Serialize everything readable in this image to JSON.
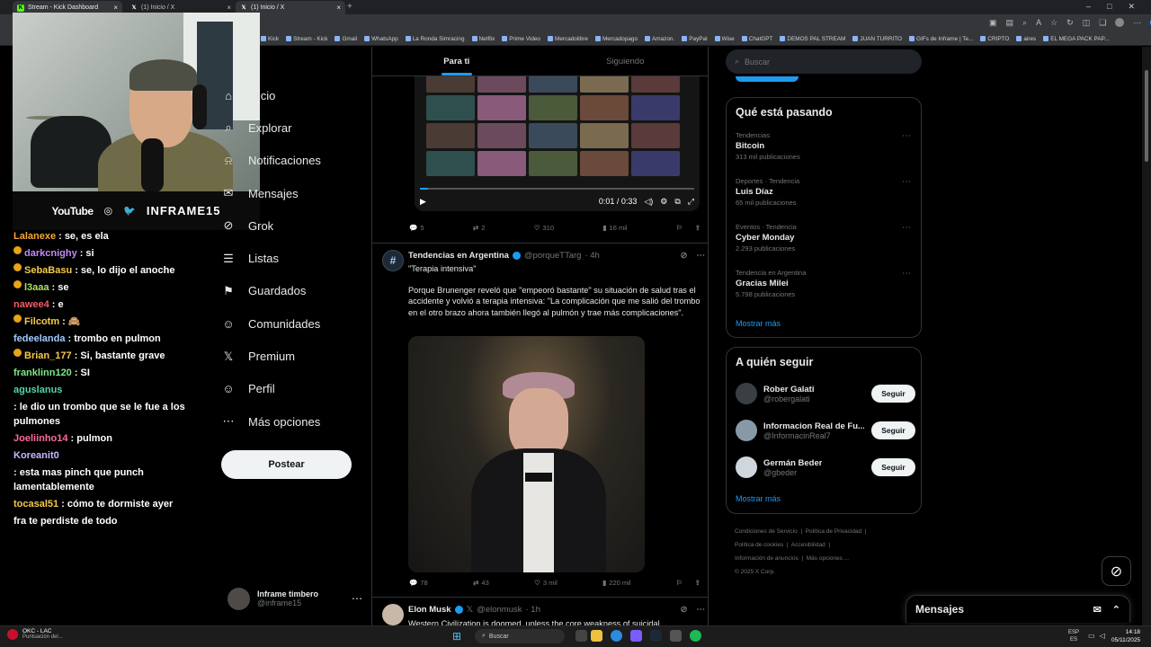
{
  "browser": {
    "tabs": [
      {
        "title": "Stream - Kick Dashboard",
        "icon": "K",
        "color": "#53fc18"
      },
      {
        "title": "(1) Inicio / X",
        "icon": "X",
        "color": "#ffffff"
      },
      {
        "title": "(1) Inicio / X",
        "icon": "X",
        "color": "#ffffff"
      }
    ],
    "bookmarks": [
      "Kick",
      "Stream - Kick",
      "Gmail",
      "WhatsApp",
      "La Ronda Simracing",
      "Netflix",
      "Prime Video",
      "Mercadolibre",
      "Mercadopago",
      "Amazon.",
      "PayPal",
      "Wise",
      "ChatGPT",
      "DEMOS PAL STREAM",
      "JUAN TURRITO",
      "GIFs de Inframe | Te...",
      "CRIPTO",
      "aires",
      "EL MEGA PACK PAP..."
    ]
  },
  "overlay": {
    "youtube_label": "YouTube",
    "channel": "INFRAME15"
  },
  "chat": [
    {
      "user": "Lalanexe",
      "text": ": se, es ela",
      "color": "#f7a534",
      "badge": false
    },
    {
      "user": "darkcnighy",
      "text": ": si",
      "color": "#c58af9",
      "badge": true
    },
    {
      "user": "SebaBasu",
      "text": ": se, lo dijo el anoche",
      "color": "#f7c948",
      "badge": true
    },
    {
      "user": "l3aaa",
      "text": ": se",
      "color": "#a8e063",
      "badge": true
    },
    {
      "user": "nawee4",
      "text": ": e",
      "color": "#f45b69",
      "badge": false
    },
    {
      "user": "Filcotm",
      "text": ": 🙈",
      "color": "#f7c948",
      "badge": true
    },
    {
      "user": "fedeelanda",
      "text": ": trombo en pulmon",
      "color": "#9ecbff",
      "badge": false
    },
    {
      "user": "Brian_177",
      "text": ": Si, bastante grave",
      "color": "#f7c948",
      "badge": true
    },
    {
      "user": "franklinn120",
      "text": ": SI",
      "color": "#7ee787",
      "badge": false
    },
    {
      "user": "aguslanus",
      "text": ": le dio un trombo que se le fue a los pulmones",
      "color": "#56d4a8",
      "badge": false
    },
    {
      "user": "Joeliinho14",
      "text": ": pulmon",
      "color": "#ff6b9d",
      "badge": false
    },
    {
      "user": "Koreanit0",
      "text": ": esta mas pinch que punch lamentablemente",
      "color": "#c9b6ff",
      "badge": false
    },
    {
      "user": "tocasal51",
      "text": ": cómo te dormiste ayer",
      "color": "#f7c948",
      "badge": false
    },
    {
      "user": "",
      "text": "fra te perdiste de todo",
      "color": "#ffffff",
      "badge": false
    }
  ],
  "nav": {
    "items": [
      {
        "label": "Inicio",
        "icon": "home-icon",
        "glyph": "⌂"
      },
      {
        "label": "Explorar",
        "icon": "search-icon",
        "glyph": "⌕"
      },
      {
        "label": "Notificaciones",
        "icon": "bell-icon",
        "glyph": "⍾"
      },
      {
        "label": "Mensajes",
        "icon": "mail-icon",
        "glyph": "✉"
      },
      {
        "label": "Grok",
        "icon": "grok-icon",
        "glyph": "⊘"
      },
      {
        "label": "Listas",
        "icon": "list-icon",
        "glyph": "☰"
      },
      {
        "label": "Guardados",
        "icon": "bookmark-icon",
        "glyph": "⚑"
      },
      {
        "label": "Comunidades",
        "icon": "people-icon",
        "glyph": "☺"
      },
      {
        "label": "Premium",
        "icon": "x-logo-icon",
        "glyph": "𝕏"
      },
      {
        "label": "Perfil",
        "icon": "person-icon",
        "glyph": "☺"
      },
      {
        "label": "Más opciones",
        "icon": "more-circle-icon",
        "glyph": "⋯"
      }
    ],
    "post_button": "Postear",
    "account_name": "Inframe timbero",
    "account_handle": "@inframe15"
  },
  "feed": {
    "tabs": [
      "Para ti",
      "Siguiendo"
    ],
    "post1": {
      "video_time": "0:01 / 0:33",
      "video_progress": 0.03,
      "replies": "5",
      "reposts": "2",
      "likes": "310",
      "views": "16 mil"
    },
    "post2": {
      "name": "Tendencias en Argentina",
      "handle": "@porqueTTarg",
      "time": "· 4h",
      "quote": "\"Terapia intensiva\"",
      "text": "Porque Brunenger reveló que \"empeoró bastante\" su situación de salud tras el accidente y volvió a terapia intensiva: \"La complicación que me salió del trombo en el otro brazo ahora también llegó al pulmón y trae más complicaciones\".",
      "replies": "78",
      "reposts": "43",
      "likes": "3 mil",
      "views": "220 mil"
    },
    "post3": {
      "name": "Elon Musk",
      "handle": "@elonmusk",
      "time": "· 1h",
      "text": "Western Civilization is doomed, unless the core weakness of suicidal"
    }
  },
  "sidebar": {
    "search_placeholder": "Buscar",
    "trends_title": "Qué está pasando",
    "trends": [
      {
        "context": "Tendencias",
        "name": "Bitcoin",
        "count": "313 mil publicaciones"
      },
      {
        "context": "Deportes · Tendencia",
        "name": "Luis Díaz",
        "count": "65 mil publicaciones"
      },
      {
        "context": "Eventos · Tendencia",
        "name": "Cyber Monday",
        "count": "2.293 publicaciones"
      },
      {
        "context": "Tendencia en Argentina",
        "name": "Gracias Milei",
        "count": "5.798 publicaciones"
      }
    ],
    "show_more": "Mostrar más",
    "follow_title": "A quién seguir",
    "follow": [
      {
        "name": "Rober Galati",
        "handle": "@robergalati",
        "button": "Seguir",
        "color": "#3a3f44"
      },
      {
        "name": "Informacion Real de Fu...",
        "handle": "@InformacinReal7",
        "button": "Seguir",
        "color": "#8899a6"
      },
      {
        "name": "Germán Beder",
        "handle": "@gbeder",
        "button": "Seguir",
        "color": "#cfd6dd"
      }
    ],
    "footer": [
      "Condiciones de Servicio",
      "Política de Privacidad",
      "Política de cookies",
      "Accesibilidad",
      "Información de anuncios",
      "Más opciones ...",
      "© 2025 X Corp."
    ],
    "messages_title": "Mensajes"
  },
  "taskbar": {
    "search": "Buscar",
    "app_title": "OKC - LAC",
    "app_sub": "Puntuación del...",
    "lang1": "ESP",
    "lang2": "ES",
    "time": "14:18",
    "date": "05/11/2025"
  },
  "colors": {
    "accent": "#1d9bf0",
    "bg": "#000000"
  }
}
